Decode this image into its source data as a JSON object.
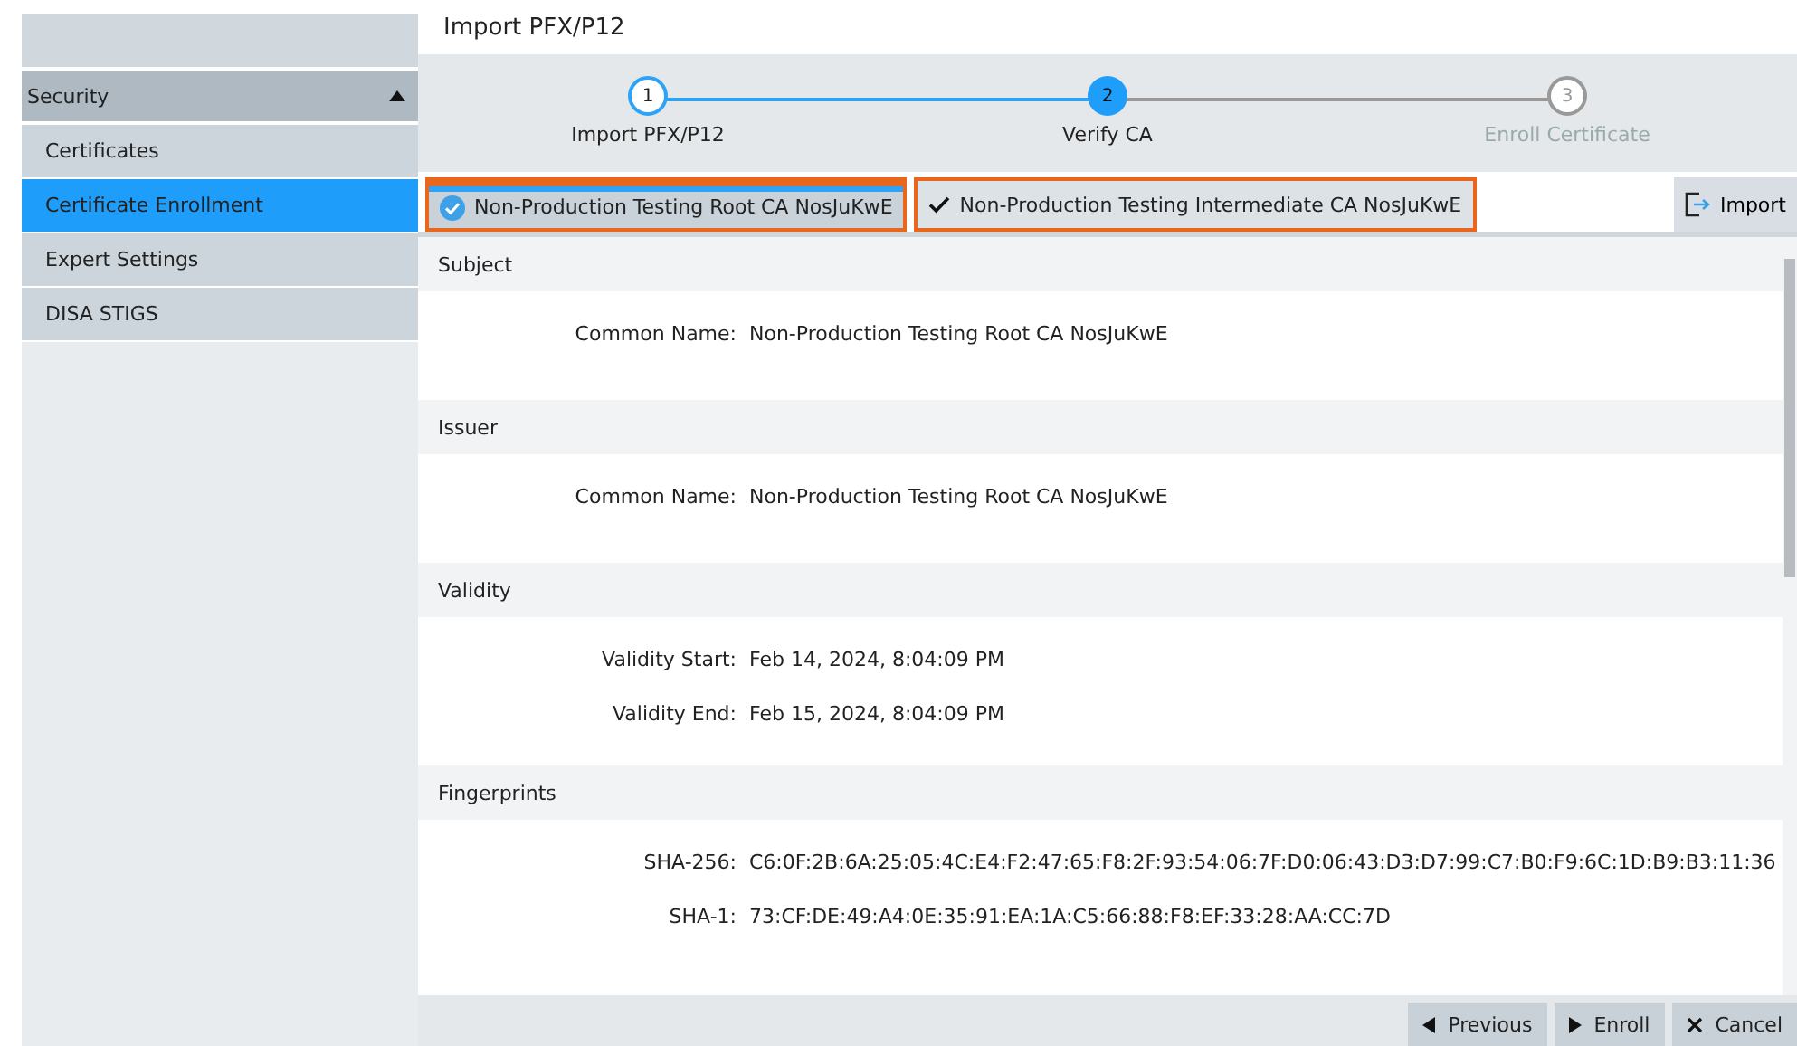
{
  "sidebar": {
    "group": {
      "label": "Security",
      "expanded": true
    },
    "items": [
      {
        "label": "Certificates",
        "selected": false
      },
      {
        "label": "Certificate Enrollment",
        "selected": true
      },
      {
        "label": "Expert Settings",
        "selected": false
      },
      {
        "label": "DISA STIGS",
        "selected": false
      }
    ]
  },
  "page_title": "Import PFX/P12",
  "steps": [
    {
      "number": "1",
      "label": "Import PFX/P12",
      "kind": "done"
    },
    {
      "number": "2",
      "label": "Verify CA",
      "kind": "current"
    },
    {
      "number": "3",
      "label": "Enroll Certificate",
      "kind": "pending"
    }
  ],
  "tabs": [
    {
      "label": "Non-Production Testing Root CA NosJuKwE",
      "selected": true
    },
    {
      "label": "Non-Production Testing Intermediate CA NosJuKwE",
      "selected": false
    }
  ],
  "import_button": "Import",
  "sections": [
    {
      "title": "Subject",
      "fields": [
        {
          "label": "Common Name:",
          "value": "Non-Production Testing Root CA NosJuKwE"
        }
      ]
    },
    {
      "title": "Issuer",
      "fields": [
        {
          "label": "Common Name:",
          "value": "Non-Production Testing Root CA NosJuKwE"
        }
      ]
    },
    {
      "title": "Validity",
      "fields": [
        {
          "label": "Validity Start:",
          "value": "Feb 14, 2024, 8:04:09 PM"
        },
        {
          "label": "Validity End:",
          "value": "Feb 15, 2024, 8:04:09 PM"
        }
      ]
    },
    {
      "title": "Fingerprints",
      "fields": [
        {
          "label": "SHA-256:",
          "value": "C6:0F:2B:6A:25:05:4C:E4:F2:47:65:F8:2F:93:54:06:7F:D0:06:43:D3:D7:99:C7:B0:F9:6C:1D:B9:B3:11:36"
        },
        {
          "label": "SHA-1:",
          "value": "73:CF:DE:49:A4:0E:35:91:EA:1A:C5:66:88:F8:EF:33:28:AA:CC:7D"
        }
      ]
    }
  ],
  "footer_buttons": [
    {
      "kind": "previous",
      "label": "Previous"
    },
    {
      "kind": "next",
      "label": "Enroll"
    },
    {
      "kind": "cancel",
      "label": "Cancel"
    }
  ]
}
